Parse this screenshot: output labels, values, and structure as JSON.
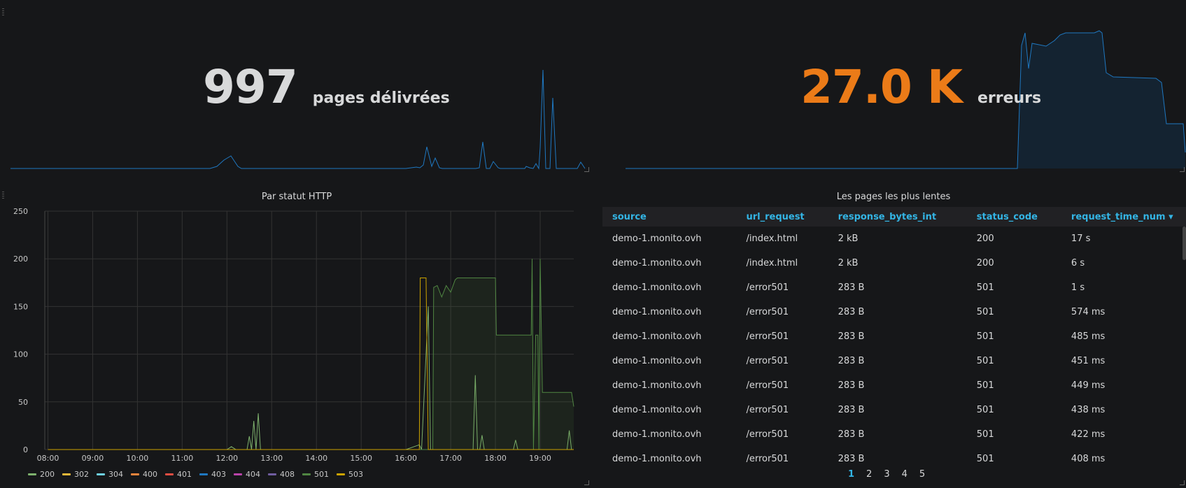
{
  "stat_left": {
    "value": "997",
    "unit": "pages délivrées",
    "value_color": "#d8d9da"
  },
  "stat_right": {
    "value": "27.0 K",
    "unit": "erreurs",
    "value_color": "#eb7b18"
  },
  "chart": {
    "title": "Par statut HTTP"
  },
  "chart_data": {
    "type": "line",
    "title": "Par statut HTTP",
    "ylim": [
      0,
      250
    ],
    "yticks": [
      "250",
      "200",
      "150",
      "100",
      "50",
      "0"
    ],
    "xticks": [
      "08:00",
      "09:00",
      "10:00",
      "11:00",
      "12:00",
      "13:00",
      "14:00",
      "15:00",
      "16:00",
      "17:00",
      "18:00",
      "19:00"
    ],
    "grid": true,
    "legend": "bottom",
    "series": [
      {
        "name": "200",
        "color": "#7eb26d",
        "points": [
          [
            8.0,
            0
          ],
          [
            12.0,
            0
          ],
          [
            12.1,
            3
          ],
          [
            12.2,
            0
          ],
          [
            12.45,
            0
          ],
          [
            12.5,
            14
          ],
          [
            12.55,
            0
          ],
          [
            12.6,
            30
          ],
          [
            12.65,
            0
          ],
          [
            12.7,
            38
          ],
          [
            12.75,
            0
          ],
          [
            16.0,
            0
          ],
          [
            16.3,
            5
          ],
          [
            16.35,
            0
          ],
          [
            16.5,
            150
          ],
          [
            16.55,
            0
          ],
          [
            16.7,
            0
          ],
          [
            17.5,
            0
          ],
          [
            17.55,
            78
          ],
          [
            17.6,
            0
          ],
          [
            17.65,
            0
          ],
          [
            17.7,
            15
          ],
          [
            17.75,
            0
          ],
          [
            18.4,
            0
          ],
          [
            18.45,
            10
          ],
          [
            18.5,
            0
          ],
          [
            19.6,
            0
          ],
          [
            19.65,
            20
          ],
          [
            19.7,
            0
          ],
          [
            19.75,
            0
          ]
        ]
      },
      {
        "name": "302",
        "color": "#eab839",
        "points": [
          [
            8.0,
            0
          ],
          [
            19.75,
            0
          ]
        ]
      },
      {
        "name": "304",
        "color": "#6ed0e0",
        "points": []
      },
      {
        "name": "400",
        "color": "#ef843c",
        "points": []
      },
      {
        "name": "401",
        "color": "#e24d42",
        "points": []
      },
      {
        "name": "403",
        "color": "#1f78c1",
        "points": []
      },
      {
        "name": "404",
        "color": "#ba43a9",
        "points": []
      },
      {
        "name": "408",
        "color": "#705da0",
        "points": []
      },
      {
        "name": "501",
        "color": "#508642",
        "points": [
          [
            8.0,
            0
          ],
          [
            16.6,
            0
          ],
          [
            16.62,
            170
          ],
          [
            16.7,
            172
          ],
          [
            16.8,
            160
          ],
          [
            16.9,
            172
          ],
          [
            17.0,
            165
          ],
          [
            17.1,
            178
          ],
          [
            17.15,
            180
          ],
          [
            18.0,
            180
          ],
          [
            18.02,
            120
          ],
          [
            18.8,
            120
          ],
          [
            18.82,
            200
          ],
          [
            18.85,
            0
          ],
          [
            18.9,
            120
          ],
          [
            18.95,
            120
          ],
          [
            18.97,
            0
          ],
          [
            19.0,
            200
          ],
          [
            19.05,
            60
          ],
          [
            19.7,
            60
          ],
          [
            19.75,
            45
          ]
        ]
      },
      {
        "name": "503",
        "color": "#cca300",
        "points": [
          [
            8.0,
            0
          ],
          [
            16.3,
            0
          ],
          [
            16.32,
            180
          ],
          [
            16.45,
            180
          ],
          [
            16.5,
            0
          ],
          [
            19.75,
            0
          ]
        ]
      }
    ]
  },
  "table": {
    "title": "Les pages les plus lentes",
    "columns": [
      "source",
      "url_request",
      "response_bytes_int",
      "status_code",
      "request_time_num"
    ],
    "sort_icon": "caret-down-icon",
    "rows": [
      [
        "demo-1.monito.ovh",
        "/index.html",
        "2 kB",
        "200",
        "17 s"
      ],
      [
        "demo-1.monito.ovh",
        "/index.html",
        "2 kB",
        "200",
        "6 s"
      ],
      [
        "demo-1.monito.ovh",
        "/error501",
        "283 B",
        "501",
        "1 s"
      ],
      [
        "demo-1.monito.ovh",
        "/error501",
        "283 B",
        "501",
        "574 ms"
      ],
      [
        "demo-1.monito.ovh",
        "/error501",
        "283 B",
        "501",
        "485 ms"
      ],
      [
        "demo-1.monito.ovh",
        "/error501",
        "283 B",
        "501",
        "451 ms"
      ],
      [
        "demo-1.monito.ovh",
        "/error501",
        "283 B",
        "501",
        "449 ms"
      ],
      [
        "demo-1.monito.ovh",
        "/error501",
        "283 B",
        "501",
        "438 ms"
      ],
      [
        "demo-1.monito.ovh",
        "/error501",
        "283 B",
        "501",
        "422 ms"
      ],
      [
        "demo-1.monito.ovh",
        "/error501",
        "283 B",
        "501",
        "408 ms"
      ]
    ],
    "pages": [
      "1",
      "2",
      "3",
      "4",
      "5"
    ],
    "active_page": "1"
  }
}
